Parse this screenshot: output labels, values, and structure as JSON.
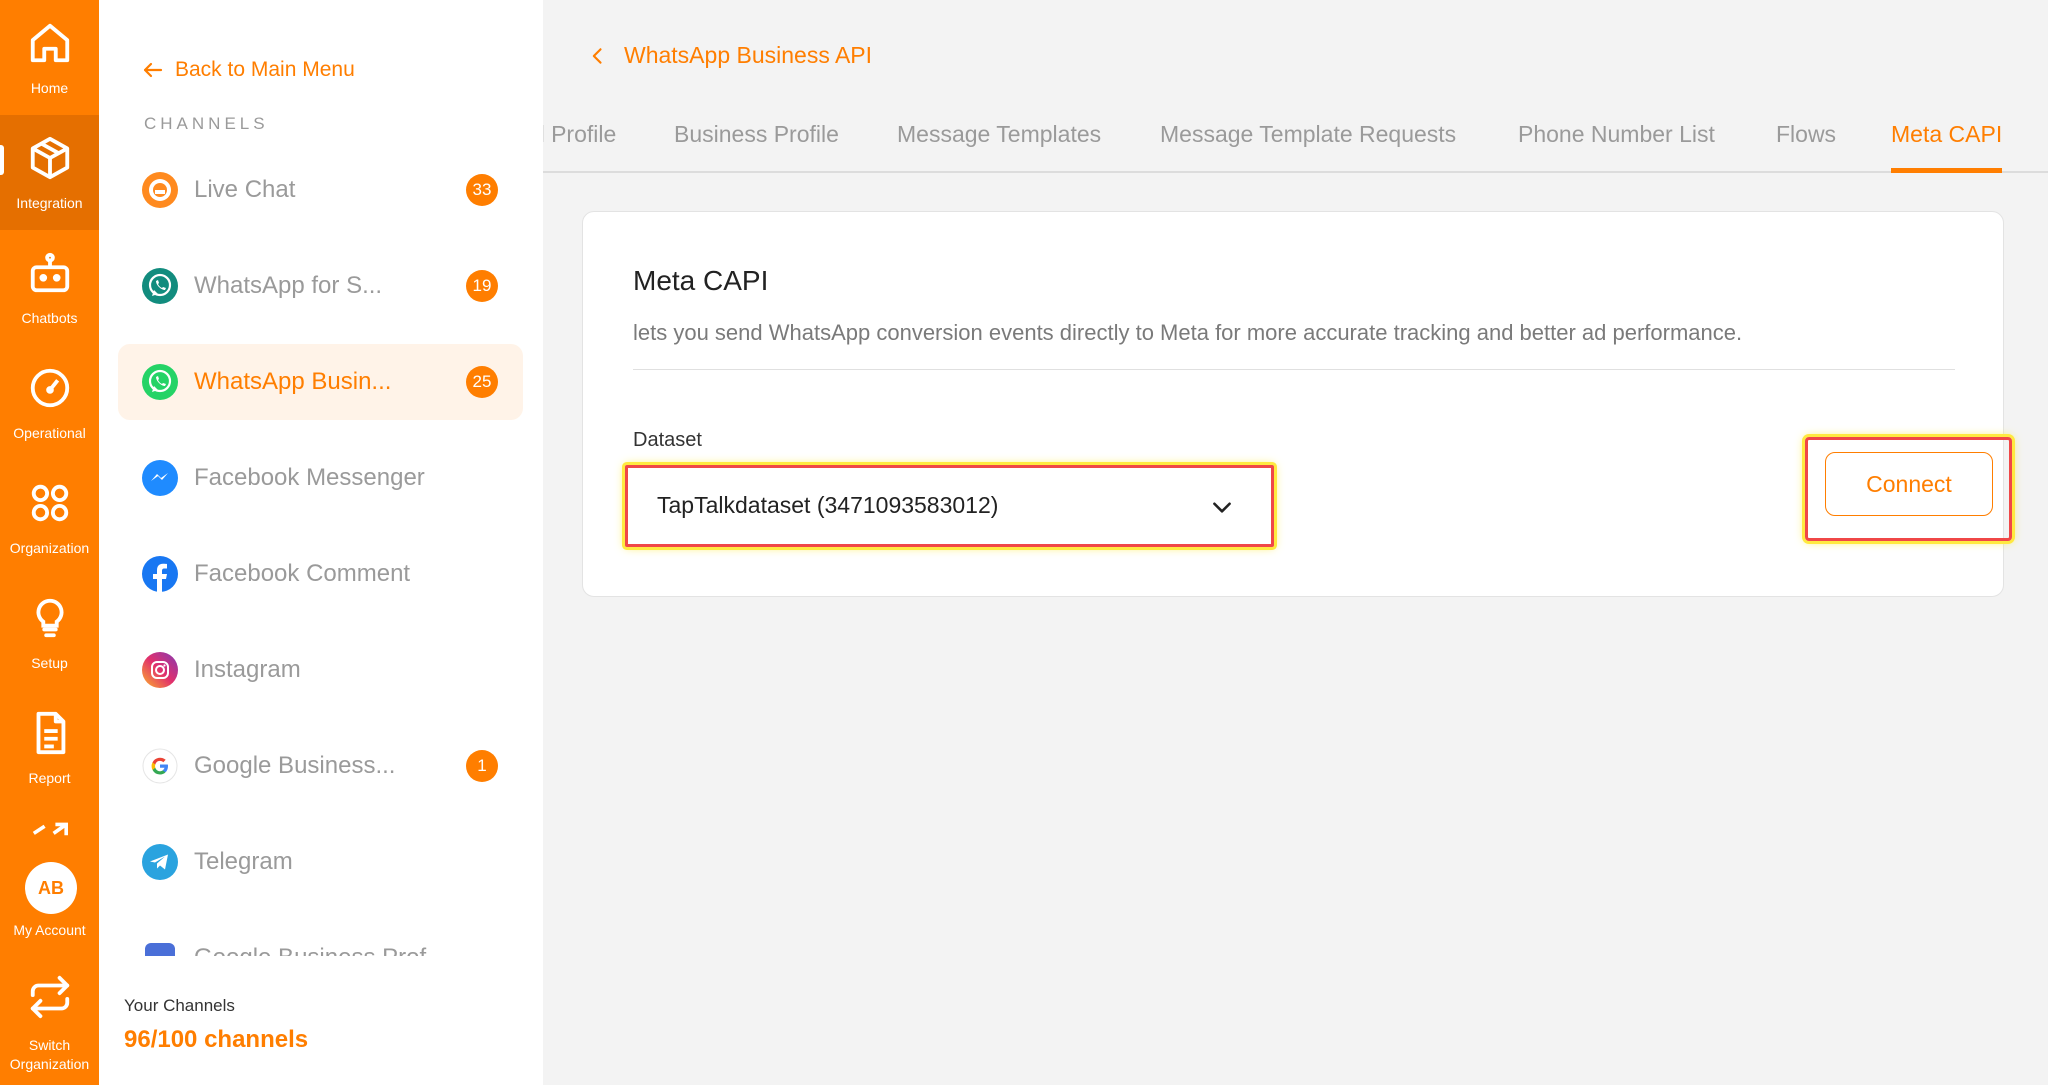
{
  "leftnav": {
    "items": [
      {
        "label": "Home",
        "icon": "home-icon"
      },
      {
        "label": "Integration",
        "icon": "cube-icon"
      },
      {
        "label": "Chatbots",
        "icon": "robot-icon"
      },
      {
        "label": "Operational",
        "icon": "gauge-icon"
      },
      {
        "label": "Organization",
        "icon": "grid-circles-icon"
      },
      {
        "label": "Setup",
        "icon": "lightbulb-icon"
      },
      {
        "label": "Report",
        "icon": "document-icon"
      },
      {
        "label": "My Account",
        "icon": "avatar"
      },
      {
        "label": "Switch",
        "label2": "Organization",
        "icon": "switch-icon"
      }
    ],
    "avatar_initials": "AB",
    "accent": "#ff7e00"
  },
  "sidebar": {
    "back_label": "Back to Main Menu",
    "section_label": "CHANNELS",
    "channels": [
      {
        "label": "Live Chat",
        "badge": "33",
        "icon": "livechat-icon"
      },
      {
        "label": "WhatsApp for S...",
        "badge": "19",
        "icon": "whatsapp-icon"
      },
      {
        "label": "WhatsApp Busin...",
        "badge": "25",
        "icon": "whatsapp-icon",
        "active": true
      },
      {
        "label": "Facebook Messenger",
        "badge": "",
        "icon": "messenger-icon"
      },
      {
        "label": "Facebook Comment",
        "badge": "",
        "icon": "facebook-icon"
      },
      {
        "label": "Instagram",
        "badge": "",
        "icon": "instagram-icon"
      },
      {
        "label": "Google Business...",
        "badge": "1",
        "icon": "google-icon"
      },
      {
        "label": "Telegram",
        "badge": "",
        "icon": "telegram-icon"
      },
      {
        "label": "Google Business Prof...",
        "badge": "",
        "icon": "google-business-icon"
      }
    ],
    "your_channels_label": "Your Channels",
    "channel_count": "96/100 channels"
  },
  "main": {
    "breadcrumb": "WhatsApp Business API",
    "tabs": [
      {
        "label": "Channel Profile"
      },
      {
        "label": "Business Profile"
      },
      {
        "label": "Message Templates"
      },
      {
        "label": "Message Template Requests"
      },
      {
        "label": "Phone Number List"
      },
      {
        "label": "Flows"
      },
      {
        "label": "Meta CAPI",
        "active": true
      }
    ],
    "card": {
      "title": "Meta CAPI",
      "description": "lets you send WhatsApp conversion events directly to Meta for more accurate tracking and better ad performance.",
      "dataset_label": "Dataset",
      "dataset_value": "TapTalkdataset (3471093583012)",
      "connect_label": "Connect"
    }
  }
}
